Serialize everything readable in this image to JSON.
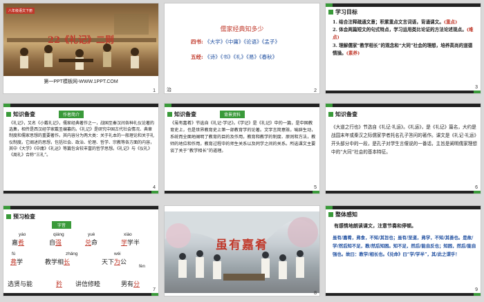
{
  "slide1": {
    "badge": "八年级语文下册",
    "title": "22《礼记》二则",
    "footer": "第一PPT模板网-WWW.1PPT.COM",
    "num": "1"
  },
  "slide2": {
    "title": "儒家经典知多少",
    "row1_label": "四书:",
    "row1_books": "《大学》《中庸》《论语》《孟子》",
    "row2_label": "五经:",
    "row2_books": "《诗》《书》《礼》《易》《春秋》",
    "corner": "治",
    "num": "2"
  },
  "slide3": {
    "heading": "学习目标",
    "goal1": "1. 结合注释疏通文意；积累重点文言词语，背诵课文。",
    "goal1_tag": "(重点)",
    "goal2": "2. 体会两篇短文的句式特点，学习运用类比论证的方法论述观点。",
    "goal2_tag": "(难点)",
    "goal3": "3. 理解儒家“教学相长”的观念和“大同”社会的理想，培养高尚的道德情操。",
    "goal3_tag": "(素养)",
    "num": "3"
  },
  "slide4": {
    "heading": "知识备查",
    "stamp": "作者简介",
    "text": "《礼记》，又名《小戴礼记》，儒家经典著作之一，战国至秦汉间各种礼仪论著的选集，相传是西汉经学家戴圣编纂的。《礼记》是研究中国古代社会情况、典章制度和儒家思想的重要著作。其内容分为两大类：关于礼本的一般理论和关于礼仪制度。它阐述的思想，包括社会、政治、伦理、哲学、宗教等各方面的内容，其中《大学》《中庸》《礼运》等篇包含较丰富的哲学思想。《礼记》与《仪礼》《周礼》合称“三礼”。",
    "num": "4"
  },
  "slide5": {
    "heading": "知识备查",
    "stamp": "背景资料",
    "text": "《虽有嘉肴》节选自《礼记·学记》。《学记》是《礼记》中的一篇，是中国教育史上，也是世界教育史上第一部教育学的论著。文字言简意赅，喻辟生动，系统而全面地阐明了教育的目的及作用，教育和教学的制度、原则和方法，教师的地位和作用，教育过程中的师生关系以及同学之间的关系。所选课文主要谈了关于“教学相长”的道理。",
    "num": "5"
  },
  "slide6": {
    "heading": "知识备查",
    "text": "《大道之行也》节选自《礼记·礼运》。《礼运》，是《礼记》篇名，大约是战国末年或秦汉之际儒家学者托名孔子答问的著作。课文是《礼记·礼运》开头部分中的一段，是孔子对学生言偃说的一番话，主旨是阐明儒家理想中的“大同”社会的基本特征。",
    "num": "6"
  },
  "slide7": {
    "heading": "预习检查",
    "stamp": "字音",
    "items": [
      {
        "pinyin": "yáo",
        "pre": "嘉",
        "char": "肴",
        "post": ""
      },
      {
        "pinyin": "qiáng",
        "pre": "自",
        "char": "强",
        "post": ""
      },
      {
        "pinyin": "yuè",
        "pre": "",
        "char": "兑",
        "post": "命"
      },
      {
        "pinyin": "xiào",
        "pre": "",
        "char": "学",
        "post": "学半"
      },
      {
        "pinyin": "fú",
        "pre": "",
        "char": "弗",
        "post": "学"
      },
      {
        "pinyin": "zhǎng",
        "pre": "教学相",
        "char": "长",
        "post": ""
      },
      {
        "pinyin": "wéi",
        "pre": "天下",
        "char": "为",
        "post": "公"
      },
      {
        "pinyin": "xuǎn",
        "pre": "",
        "char": "选",
        "post": "贤与能"
      },
      {
        "pinyin": "fèn",
        "pre": "男有",
        "char": "分",
        "post": ""
      }
    ],
    "row3": [
      "选贤与能",
      "矜",
      "讲信修睦",
      "男有分"
    ],
    "num": "7"
  },
  "slide8": {
    "title": "虽有嘉肴",
    "num": "8"
  },
  "slide9": {
    "heading": "整体感知",
    "instruction": "有感情地朗读课文，注意节奏和停顿。",
    "text": "虽有/嘉肴，弗食，不知/其旨也；虽有/至道，弗学，不知/其善也。是故/学/然后知不足，教/然后知困。知不足，然后/能自反也；知困，然后/能自强也。故曰：教学/相长也。《兑命》曰“学/学半”，其/此之谓乎！",
    "num": "9"
  }
}
